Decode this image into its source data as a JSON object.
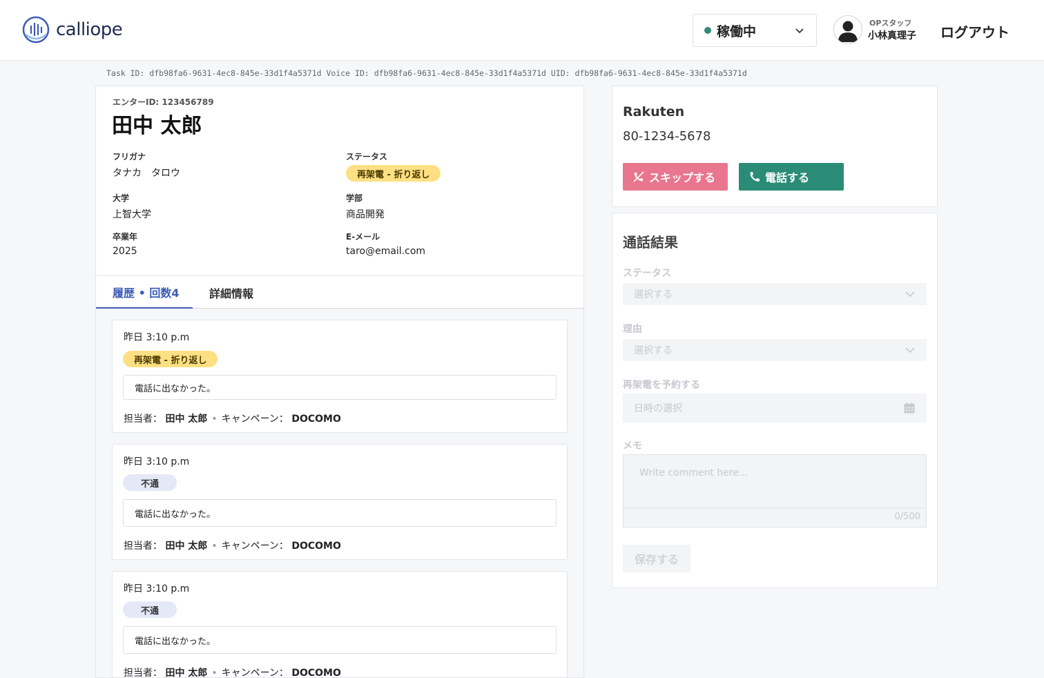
{
  "header": {
    "logo_text": "calliope",
    "status_label": "稼働中",
    "user_role": "OPスタッフ",
    "user_name": "小林真理子",
    "logout_label": "ログアウト"
  },
  "ids_line": "Task ID: dfb98fa6-9631-4ec8-845e-33d1f4a5371d  Voice ID: dfb98fa6-9631-4ec8-845e-33d1f4a5371d  UID: dfb98fa6-9631-4ec8-845e-33d1f4a5371d",
  "profile": {
    "enter_id": "エンターID: 123456789",
    "name": "田中 太郎",
    "furigana_label": "フリガナ",
    "furigana_value": "タナカ　タロウ",
    "status_label": "ステータス",
    "status_value": "再架電 - 折り返し",
    "university_label": "大学",
    "university_value": "上智大学",
    "faculty_label": "学部",
    "faculty_value": "商品開発",
    "grad_label": "卒業年",
    "grad_value": "2025",
    "email_label": "E-メール",
    "email_value": "taro@email.com"
  },
  "tabs": {
    "history": "履歴 • 回数4",
    "details": "詳細情報"
  },
  "history": [
    {
      "time": "昨日 3:10 p.m",
      "badge": "再架電 - 折り返し",
      "note": "電話に出なかった。",
      "assignee_label": "担当者：",
      "assignee": "田中 太郎",
      "campaign_label": "キャンペーン：",
      "campaign": "DOCOMO"
    },
    {
      "time": "昨日 3:10 p.m",
      "badge": "不通",
      "note": "電話に出なかった。",
      "assignee_label": "担当者：",
      "assignee": "田中 太郎",
      "campaign_label": "キャンペーン：",
      "campaign": "DOCOMO"
    },
    {
      "time": "昨日 3:10 p.m",
      "badge": "不通",
      "note": "電話に出なかった。",
      "assignee_label": "担当者：",
      "assignee": "田中 太郎",
      "campaign_label": "キャンペーン：",
      "campaign": "DOCOMO"
    }
  ],
  "company": {
    "name": "Rakuten",
    "phone": "80-1234-5678",
    "skip_label": "スキップする",
    "call_label": "電話する"
  },
  "result": {
    "title": "通話結果",
    "status_label": "ステータス",
    "status_placeholder": "選択する",
    "reason_label": "理由",
    "reason_placeholder": "選択する",
    "recall_label": "再架電を予約する",
    "recall_placeholder": "日時の選択",
    "memo_label": "メモ",
    "memo_placeholder": "Write comment here...",
    "memo_count": "0/500",
    "save_label": "保存する"
  },
  "colors": {
    "accent": "#3b5bb5",
    "call_green": "#2a8c76",
    "skip_pink": "#e8768e",
    "badge_yellow": "#fde083",
    "badge_blue": "#e4e8f7"
  }
}
